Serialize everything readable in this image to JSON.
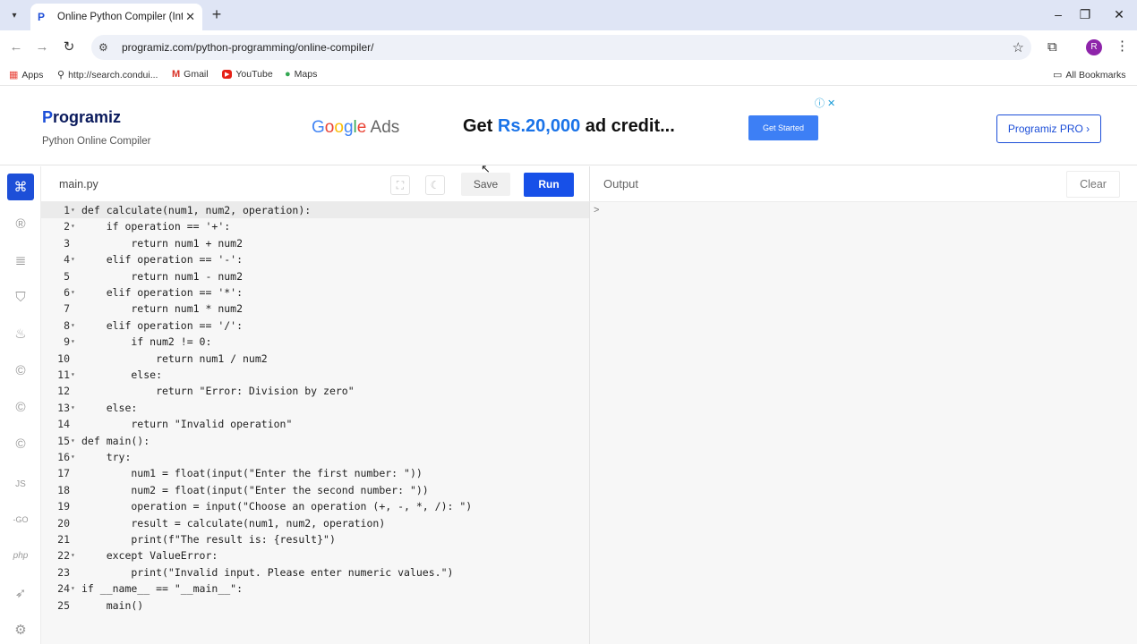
{
  "browser": {
    "tab_title": "Online Python Compiler (Interp",
    "tab_favicon": "P",
    "url": "programiz.com/python-programming/online-compiler/",
    "bookmarks": [
      {
        "icon": "apps-grid-icon",
        "label": "Apps"
      },
      {
        "icon": "search-icon",
        "label": "http://search.condui..."
      },
      {
        "icon": "gmail-icon",
        "label": "Gmail"
      },
      {
        "icon": "youtube-icon",
        "label": "YouTube"
      },
      {
        "icon": "maps-pin-icon",
        "label": "Maps"
      }
    ],
    "all_bookmarks": "All Bookmarks",
    "profile_initial": "R"
  },
  "header": {
    "logo_p": "P",
    "logo_rest": "rogramiz",
    "subtitle": "Python Online Compiler",
    "ad": {
      "google": [
        "G",
        "o",
        "o",
        "g",
        "l",
        "e"
      ],
      "ads": " Ads",
      "headline_pre": "Get ",
      "headline_amount": "Rs.20,000",
      "headline_post": " ad credit...",
      "cta": "Get Started",
      "choice": "ⓘ ✕"
    },
    "pro_button": "Programiz PRO ›"
  },
  "editor": {
    "filename": "main.py",
    "save_label": "Save",
    "run_label": "Run",
    "lines": [
      {
        "n": "1",
        "fold": true,
        "code": "def calculate(num1, num2, operation):"
      },
      {
        "n": "2",
        "fold": true,
        "code": "    if operation == '+':"
      },
      {
        "n": "3",
        "fold": false,
        "code": "        return num1 + num2"
      },
      {
        "n": "4",
        "fold": true,
        "code": "    elif operation == '-':"
      },
      {
        "n": "5",
        "fold": false,
        "code": "        return num1 - num2"
      },
      {
        "n": "6",
        "fold": true,
        "code": "    elif operation == '*':"
      },
      {
        "n": "7",
        "fold": false,
        "code": "        return num1 * num2"
      },
      {
        "n": "8",
        "fold": true,
        "code": "    elif operation == '/':"
      },
      {
        "n": "9",
        "fold": true,
        "code": "        if num2 != 0:"
      },
      {
        "n": "10",
        "fold": false,
        "code": "            return num1 / num2"
      },
      {
        "n": "11",
        "fold": true,
        "code": "        else:"
      },
      {
        "n": "12",
        "fold": false,
        "code": "            return \"Error: Division by zero\""
      },
      {
        "n": "13",
        "fold": true,
        "code": "    else:"
      },
      {
        "n": "14",
        "fold": false,
        "code": "        return \"Invalid operation\""
      },
      {
        "n": "15",
        "fold": true,
        "code": "def main():"
      },
      {
        "n": "16",
        "fold": true,
        "code": "    try:"
      },
      {
        "n": "17",
        "fold": false,
        "code": "        num1 = float(input(\"Enter the first number: \"))"
      },
      {
        "n": "18",
        "fold": false,
        "code": "        num2 = float(input(\"Enter the second number: \"))"
      },
      {
        "n": "19",
        "fold": false,
        "code": "        operation = input(\"Choose an operation (+, -, *, /): \")"
      },
      {
        "n": "20",
        "fold": false,
        "code": "        result = calculate(num1, num2, operation)"
      },
      {
        "n": "21",
        "fold": false,
        "code": "        print(f\"The result is: {result}\")"
      },
      {
        "n": "22",
        "fold": true,
        "code": "    except ValueError:"
      },
      {
        "n": "23",
        "fold": false,
        "code": "        print(\"Invalid input. Please enter numeric values.\")"
      },
      {
        "n": "24",
        "fold": true,
        "code": "if __name__ == \"__main__\":"
      },
      {
        "n": "25",
        "fold": false,
        "code": "    main()"
      }
    ]
  },
  "output": {
    "label": "Output",
    "clear_label": "Clear",
    "prompt": ">"
  },
  "sidebar": {
    "items": [
      "python-icon",
      "r-icon",
      "sql-icon",
      "html-icon",
      "java-icon",
      "c-icon",
      "cpp-icon",
      "csharp-icon",
      "js-icon",
      "go-icon",
      "php-icon",
      "swift-icon",
      "rust-icon"
    ],
    "labels": {
      "js": "JS",
      "go": "-GO",
      "php": "php"
    }
  }
}
